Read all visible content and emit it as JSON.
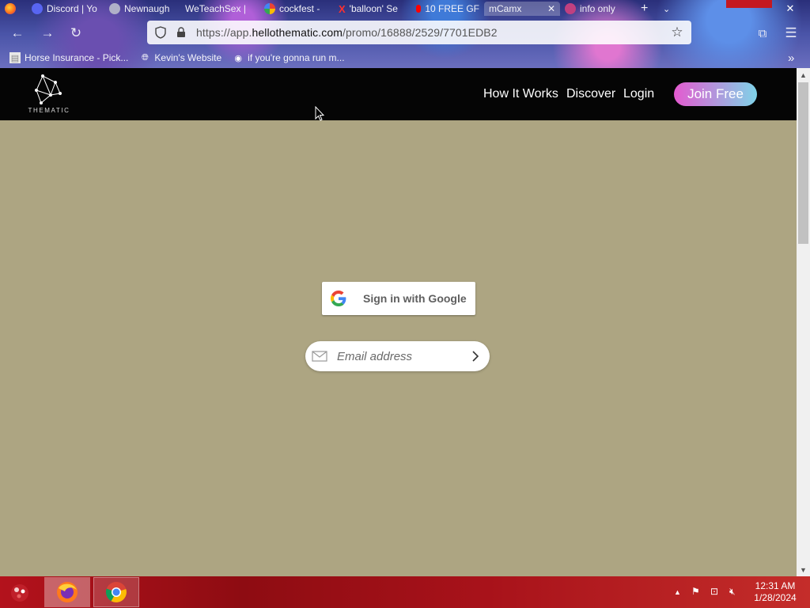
{
  "browser": {
    "tabs": [
      {
        "label": "Discord | Yo",
        "color": "#5865f2"
      },
      {
        "label": "Newnaugh",
        "color": "#b0b0c8"
      },
      {
        "label": "WeTeachSex |",
        "color": "#d04070"
      },
      {
        "label": "cockfest -",
        "color": "#ffffff"
      },
      {
        "label": "'balloon' Se",
        "color": "#e03030"
      },
      {
        "label": "10 FREE GF",
        "color": "#ff0000"
      },
      {
        "label": "mCamx",
        "color": "#9090a0"
      },
      {
        "label": "info only",
        "color": "#c04080"
      }
    ],
    "url_prefix": "https://app.",
    "url_domain": "hellothematic.com",
    "url_path": "/promo/16888/2529/7701EDB2",
    "bookmarks": [
      {
        "label": "Horse Insurance - Pick...",
        "icon": "page-icon"
      },
      {
        "label": "Kevin's Website",
        "icon": "globe-icon"
      },
      {
        "label": "if you're gonna run m...",
        "icon": "site-icon"
      }
    ]
  },
  "site": {
    "logo_text": "THEMATIC",
    "nav": {
      "how_it_works": "How It Works",
      "discover": "Discover",
      "login": "Login",
      "join": "Join Free"
    },
    "google_button": "Sign in with Google",
    "email_placeholder": "Email address"
  },
  "taskbar": {
    "time": "12:31 AM",
    "date": "1/28/2024"
  },
  "colors": {
    "page_background": "#ada582",
    "header_background": "#050505",
    "join_gradient_start": "#e45ad0",
    "join_gradient_end": "#7fd3e8"
  }
}
